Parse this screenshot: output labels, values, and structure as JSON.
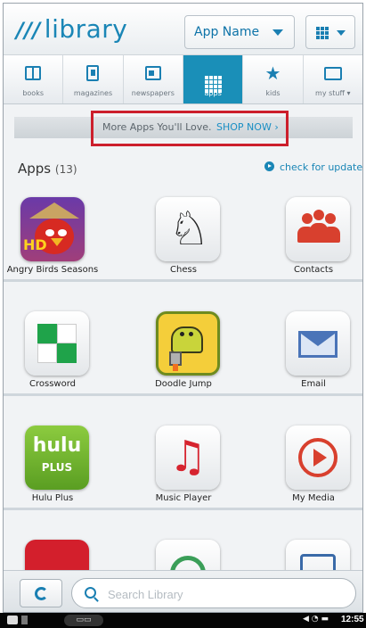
{
  "header": {
    "logo_text": "library",
    "app_name_label": "App Name"
  },
  "tabs": [
    {
      "label": "books",
      "icon": "book-icon"
    },
    {
      "label": "magazines",
      "icon": "magazine-icon"
    },
    {
      "label": "newspapers",
      "icon": "newspaper-icon"
    },
    {
      "label": "apps",
      "icon": "apps-grid-icon",
      "active": true
    },
    {
      "label": "kids",
      "icon": "star-icon"
    },
    {
      "label": "my stuff ▾",
      "icon": "folder-icon"
    }
  ],
  "promo": {
    "text": "More Apps You'll Love.",
    "link": "SHOP NOW ›"
  },
  "apps_section": {
    "title": "Apps",
    "count": "(13)",
    "check_updates": "check for updates"
  },
  "apps": [
    {
      "name": "Angry Birds Seasons",
      "icon": "angry-birds-icon"
    },
    {
      "name": "Chess",
      "icon": "chess-knight-icon"
    },
    {
      "name": "Contacts",
      "icon": "contacts-icon"
    },
    {
      "name": "Crossword",
      "icon": "crossword-icon"
    },
    {
      "name": "Doodle Jump",
      "icon": "doodle-jump-icon"
    },
    {
      "name": "Email",
      "icon": "envelope-icon"
    },
    {
      "name": "Hulu Plus",
      "icon": "hulu-icon"
    },
    {
      "name": "Music Player",
      "icon": "music-note-icon"
    },
    {
      "name": "My Media",
      "icon": "play-icon"
    },
    {
      "name": "",
      "icon": "red-app-icon"
    },
    {
      "name": "",
      "icon": "green-app-icon"
    },
    {
      "name": "",
      "icon": "blue-app-icon"
    }
  ],
  "tile_text": {
    "hulu_main": "hulu",
    "hulu_sub": "PLUS",
    "angry_hd": "HD"
  },
  "footer": {
    "search_placeholder": "Search Library"
  },
  "status_bar": {
    "time": "12:55"
  },
  "colors": {
    "accent": "#1a8fb8",
    "promo_border": "#cc1f2c",
    "link": "#1a86b6"
  }
}
